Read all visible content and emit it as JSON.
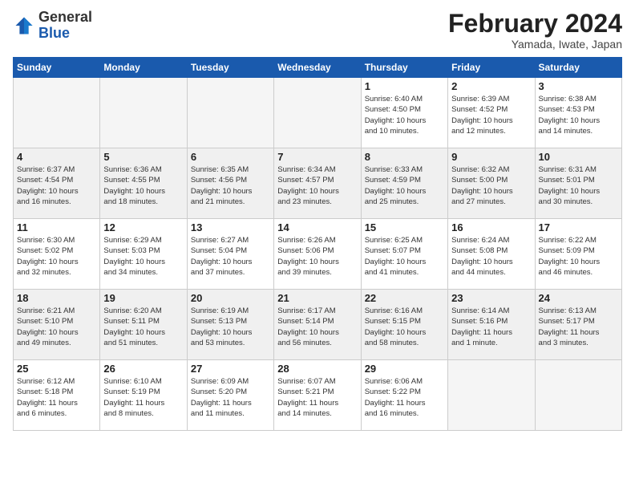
{
  "header": {
    "logo_general": "General",
    "logo_blue": "Blue",
    "title": "February 2024",
    "location": "Yamada, Iwate, Japan"
  },
  "weekdays": [
    "Sunday",
    "Monday",
    "Tuesday",
    "Wednesday",
    "Thursday",
    "Friday",
    "Saturday"
  ],
  "weeks": [
    [
      {
        "day": "",
        "info": ""
      },
      {
        "day": "",
        "info": ""
      },
      {
        "day": "",
        "info": ""
      },
      {
        "day": "",
        "info": ""
      },
      {
        "day": "1",
        "info": "Sunrise: 6:40 AM\nSunset: 4:50 PM\nDaylight: 10 hours\nand 10 minutes."
      },
      {
        "day": "2",
        "info": "Sunrise: 6:39 AM\nSunset: 4:52 PM\nDaylight: 10 hours\nand 12 minutes."
      },
      {
        "day": "3",
        "info": "Sunrise: 6:38 AM\nSunset: 4:53 PM\nDaylight: 10 hours\nand 14 minutes."
      }
    ],
    [
      {
        "day": "4",
        "info": "Sunrise: 6:37 AM\nSunset: 4:54 PM\nDaylight: 10 hours\nand 16 minutes."
      },
      {
        "day": "5",
        "info": "Sunrise: 6:36 AM\nSunset: 4:55 PM\nDaylight: 10 hours\nand 18 minutes."
      },
      {
        "day": "6",
        "info": "Sunrise: 6:35 AM\nSunset: 4:56 PM\nDaylight: 10 hours\nand 21 minutes."
      },
      {
        "day": "7",
        "info": "Sunrise: 6:34 AM\nSunset: 4:57 PM\nDaylight: 10 hours\nand 23 minutes."
      },
      {
        "day": "8",
        "info": "Sunrise: 6:33 AM\nSunset: 4:59 PM\nDaylight: 10 hours\nand 25 minutes."
      },
      {
        "day": "9",
        "info": "Sunrise: 6:32 AM\nSunset: 5:00 PM\nDaylight: 10 hours\nand 27 minutes."
      },
      {
        "day": "10",
        "info": "Sunrise: 6:31 AM\nSunset: 5:01 PM\nDaylight: 10 hours\nand 30 minutes."
      }
    ],
    [
      {
        "day": "11",
        "info": "Sunrise: 6:30 AM\nSunset: 5:02 PM\nDaylight: 10 hours\nand 32 minutes."
      },
      {
        "day": "12",
        "info": "Sunrise: 6:29 AM\nSunset: 5:03 PM\nDaylight: 10 hours\nand 34 minutes."
      },
      {
        "day": "13",
        "info": "Sunrise: 6:27 AM\nSunset: 5:04 PM\nDaylight: 10 hours\nand 37 minutes."
      },
      {
        "day": "14",
        "info": "Sunrise: 6:26 AM\nSunset: 5:06 PM\nDaylight: 10 hours\nand 39 minutes."
      },
      {
        "day": "15",
        "info": "Sunrise: 6:25 AM\nSunset: 5:07 PM\nDaylight: 10 hours\nand 41 minutes."
      },
      {
        "day": "16",
        "info": "Sunrise: 6:24 AM\nSunset: 5:08 PM\nDaylight: 10 hours\nand 44 minutes."
      },
      {
        "day": "17",
        "info": "Sunrise: 6:22 AM\nSunset: 5:09 PM\nDaylight: 10 hours\nand 46 minutes."
      }
    ],
    [
      {
        "day": "18",
        "info": "Sunrise: 6:21 AM\nSunset: 5:10 PM\nDaylight: 10 hours\nand 49 minutes."
      },
      {
        "day": "19",
        "info": "Sunrise: 6:20 AM\nSunset: 5:11 PM\nDaylight: 10 hours\nand 51 minutes."
      },
      {
        "day": "20",
        "info": "Sunrise: 6:19 AM\nSunset: 5:13 PM\nDaylight: 10 hours\nand 53 minutes."
      },
      {
        "day": "21",
        "info": "Sunrise: 6:17 AM\nSunset: 5:14 PM\nDaylight: 10 hours\nand 56 minutes."
      },
      {
        "day": "22",
        "info": "Sunrise: 6:16 AM\nSunset: 5:15 PM\nDaylight: 10 hours\nand 58 minutes."
      },
      {
        "day": "23",
        "info": "Sunrise: 6:14 AM\nSunset: 5:16 PM\nDaylight: 11 hours\nand 1 minute."
      },
      {
        "day": "24",
        "info": "Sunrise: 6:13 AM\nSunset: 5:17 PM\nDaylight: 11 hours\nand 3 minutes."
      }
    ],
    [
      {
        "day": "25",
        "info": "Sunrise: 6:12 AM\nSunset: 5:18 PM\nDaylight: 11 hours\nand 6 minutes."
      },
      {
        "day": "26",
        "info": "Sunrise: 6:10 AM\nSunset: 5:19 PM\nDaylight: 11 hours\nand 8 minutes."
      },
      {
        "day": "27",
        "info": "Sunrise: 6:09 AM\nSunset: 5:20 PM\nDaylight: 11 hours\nand 11 minutes."
      },
      {
        "day": "28",
        "info": "Sunrise: 6:07 AM\nSunset: 5:21 PM\nDaylight: 11 hours\nand 14 minutes."
      },
      {
        "day": "29",
        "info": "Sunrise: 6:06 AM\nSunset: 5:22 PM\nDaylight: 11 hours\nand 16 minutes."
      },
      {
        "day": "",
        "info": ""
      },
      {
        "day": "",
        "info": ""
      }
    ]
  ]
}
